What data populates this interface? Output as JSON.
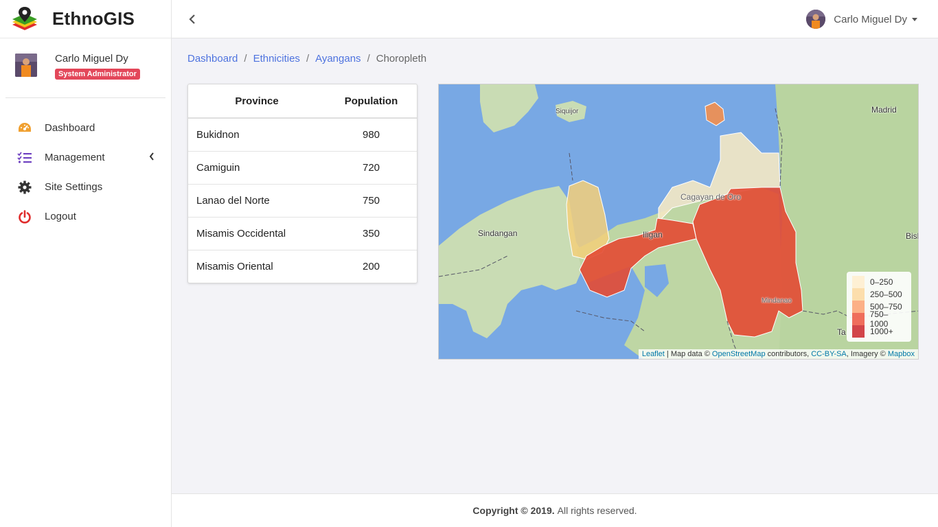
{
  "app": {
    "title": "EthnoGIS"
  },
  "sidebar": {
    "profile": {
      "name": "Carlo Miguel Dy",
      "role": "System Administrator"
    },
    "items": [
      {
        "label": "Dashboard",
        "icon": "speedometer-icon"
      },
      {
        "label": "Management",
        "icon": "list-check-icon"
      },
      {
        "label": "Site Settings",
        "icon": "gear-icon"
      },
      {
        "label": "Logout",
        "icon": "power-icon"
      }
    ]
  },
  "topbar": {
    "user_name": "Carlo Miguel Dy"
  },
  "breadcrumb": {
    "items": [
      {
        "label": "Dashboard"
      },
      {
        "label": "Ethnicities"
      },
      {
        "label": "Ayangans"
      }
    ],
    "active": "Choropleth"
  },
  "table": {
    "headers": [
      "Province",
      "Population"
    ],
    "rows": [
      {
        "province": "Bukidnon",
        "population": "980"
      },
      {
        "province": "Camiguin",
        "population": "720"
      },
      {
        "province": "Lanao del Norte",
        "population": "750"
      },
      {
        "province": "Misamis Occidental",
        "population": "350"
      },
      {
        "province": "Misamis Oriental",
        "population": "200"
      }
    ]
  },
  "map": {
    "place_labels": [
      "Siquijor",
      "Madrid",
      "Sindangan",
      "Cagayan de Oro",
      "Iligan",
      "Mindanao",
      "Bisl",
      "Ta"
    ],
    "legend": [
      {
        "label": "0–250",
        "color": "#ffeecc"
      },
      {
        "label": "250–500",
        "color": "#fdd79a"
      },
      {
        "label": "500–750",
        "color": "#fc9d6b"
      },
      {
        "label": "750–1000",
        "color": "#ec4b36"
      },
      {
        "label": "1000+",
        "color": "#c8181e"
      }
    ],
    "fills": {
      "bukidnon": "#e34a33",
      "camiguin": "#f28e4e",
      "lanao_del_norte": "#e34a33",
      "misamis_occidental": "#f3cf7a",
      "misamis_oriental": "#f4e8c3"
    },
    "attribution": {
      "leaflet": "Leaflet",
      "sep1": " | Map data © ",
      "osm": "OpenStreetMap",
      "sep2": " contributors, ",
      "license": "CC-BY-SA",
      "sep3": ", Imagery © ",
      "mapbox": "Mapbox"
    }
  },
  "footer": {
    "copyright": "Copyright © 2019.",
    "rights": "All rights reserved."
  },
  "colors": {
    "accent": "#4e73df",
    "badge": "#e3475a",
    "logout": "#e02d2d",
    "management": "#6f42c1",
    "dashboard": "#f0a030"
  }
}
